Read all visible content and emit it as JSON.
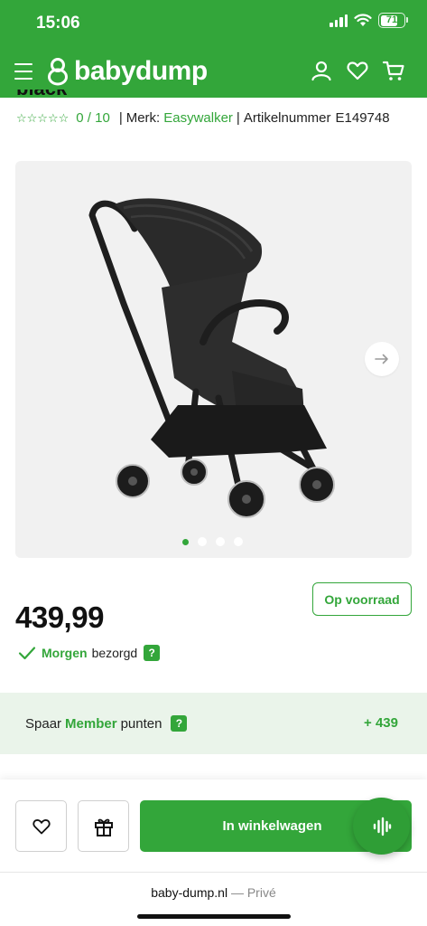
{
  "status_bar": {
    "time": "15:06",
    "battery": "71"
  },
  "header": {
    "logo_text": "babydump"
  },
  "product": {
    "title_fragment": "black",
    "stars": "☆☆☆☆☆",
    "rating": "0 / 10",
    "separator": "|",
    "brand_label": "Merk:",
    "brand": "Easywalker",
    "article_label": "Artikelnummer",
    "article_number": "E149748"
  },
  "gallery": {
    "slide_count": 4,
    "active_slide": 1
  },
  "price": {
    "value": "439,99",
    "stock_label": "Op voorraad"
  },
  "delivery": {
    "day": "Morgen",
    "text": "bezorgd",
    "help": "?"
  },
  "member": {
    "prefix": "Spaar",
    "highlight": "Member",
    "suffix": "punten",
    "help": "?",
    "points": "+ 439"
  },
  "actions": {
    "cart_label": "In winkelwagen"
  },
  "browser": {
    "url": "baby-dump.nl",
    "mode": " — Privé"
  },
  "colors": {
    "brand_green": "#33a63a",
    "member_bg": "#eaf4ea",
    "gallery_bg": "#f1f1f1"
  },
  "icons": [
    "menu-icon",
    "baby-logo-icon",
    "user-icon",
    "heart-icon",
    "cart-icon",
    "arrow-right-icon",
    "check-icon",
    "gift-icon",
    "voice-icon"
  ]
}
